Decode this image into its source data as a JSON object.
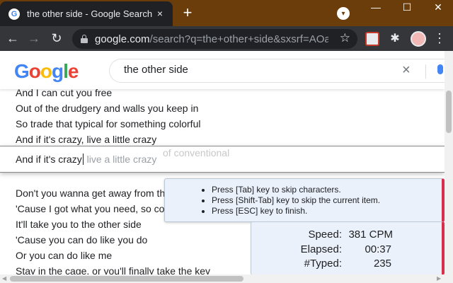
{
  "browser": {
    "tab_title": "the other side - Google Search",
    "tab_favicon": "G",
    "close_tab_icon": "×",
    "new_tab_icon": "+",
    "tab_search_icon": "▾",
    "minimize_icon": "—",
    "maximize_icon": "☐",
    "close_window_icon": "✕",
    "back_icon": "←",
    "forward_icon": "→",
    "reload_icon": "↻",
    "url_host": "google.com",
    "url_path": "/search?q=the+other+side&sxsrf=AOa...",
    "bookmark_icon": "☆",
    "extensions_icon": "✱",
    "menu_icon": "⋮"
  },
  "google": {
    "logo_letters": [
      "G",
      "o",
      "o",
      "g",
      "l",
      "e"
    ],
    "logo_colors": [
      "#4285f4",
      "#ea4335",
      "#fbbc05",
      "#4285f4",
      "#34a853",
      "#ea4335"
    ],
    "search_value": "the other side",
    "clear_icon": "×"
  },
  "lyrics_upper": [
    "And I can cut you free",
    "Out of the drudgery and walls you keep in",
    "So trade that typical for something colorful",
    "And if it's crazy, live a little crazy"
  ],
  "lyrics_lower": [
    "Don't you wanna get away from th",
    "'Cause I got what you need, so co",
    "It'll take you to the other side",
    "'Cause you can do like you do",
    "Or you can do like me",
    "Stay in the cage, or you'll finally take the key"
  ],
  "typing": {
    "ghost_text": "of conventional",
    "typed": "And if it's crazy",
    "remaining": " live a little crazy"
  },
  "instructions": [
    "Press [Tab] key to skip characters.",
    "Press [Shift-Tab] key to skip the current item.",
    "Press [ESC] key to finish."
  ],
  "stats": {
    "speed_label": "Speed:",
    "speed_value": "381 CPM",
    "elapsed_label": "Elapsed:",
    "elapsed_value": "00:37",
    "typed_label": "#Typed:",
    "typed_value": "235"
  },
  "colors": {
    "titlebar": "#6b3d0a",
    "accent_red": "#d6304a",
    "panel_bg": "#eaf1fb"
  }
}
